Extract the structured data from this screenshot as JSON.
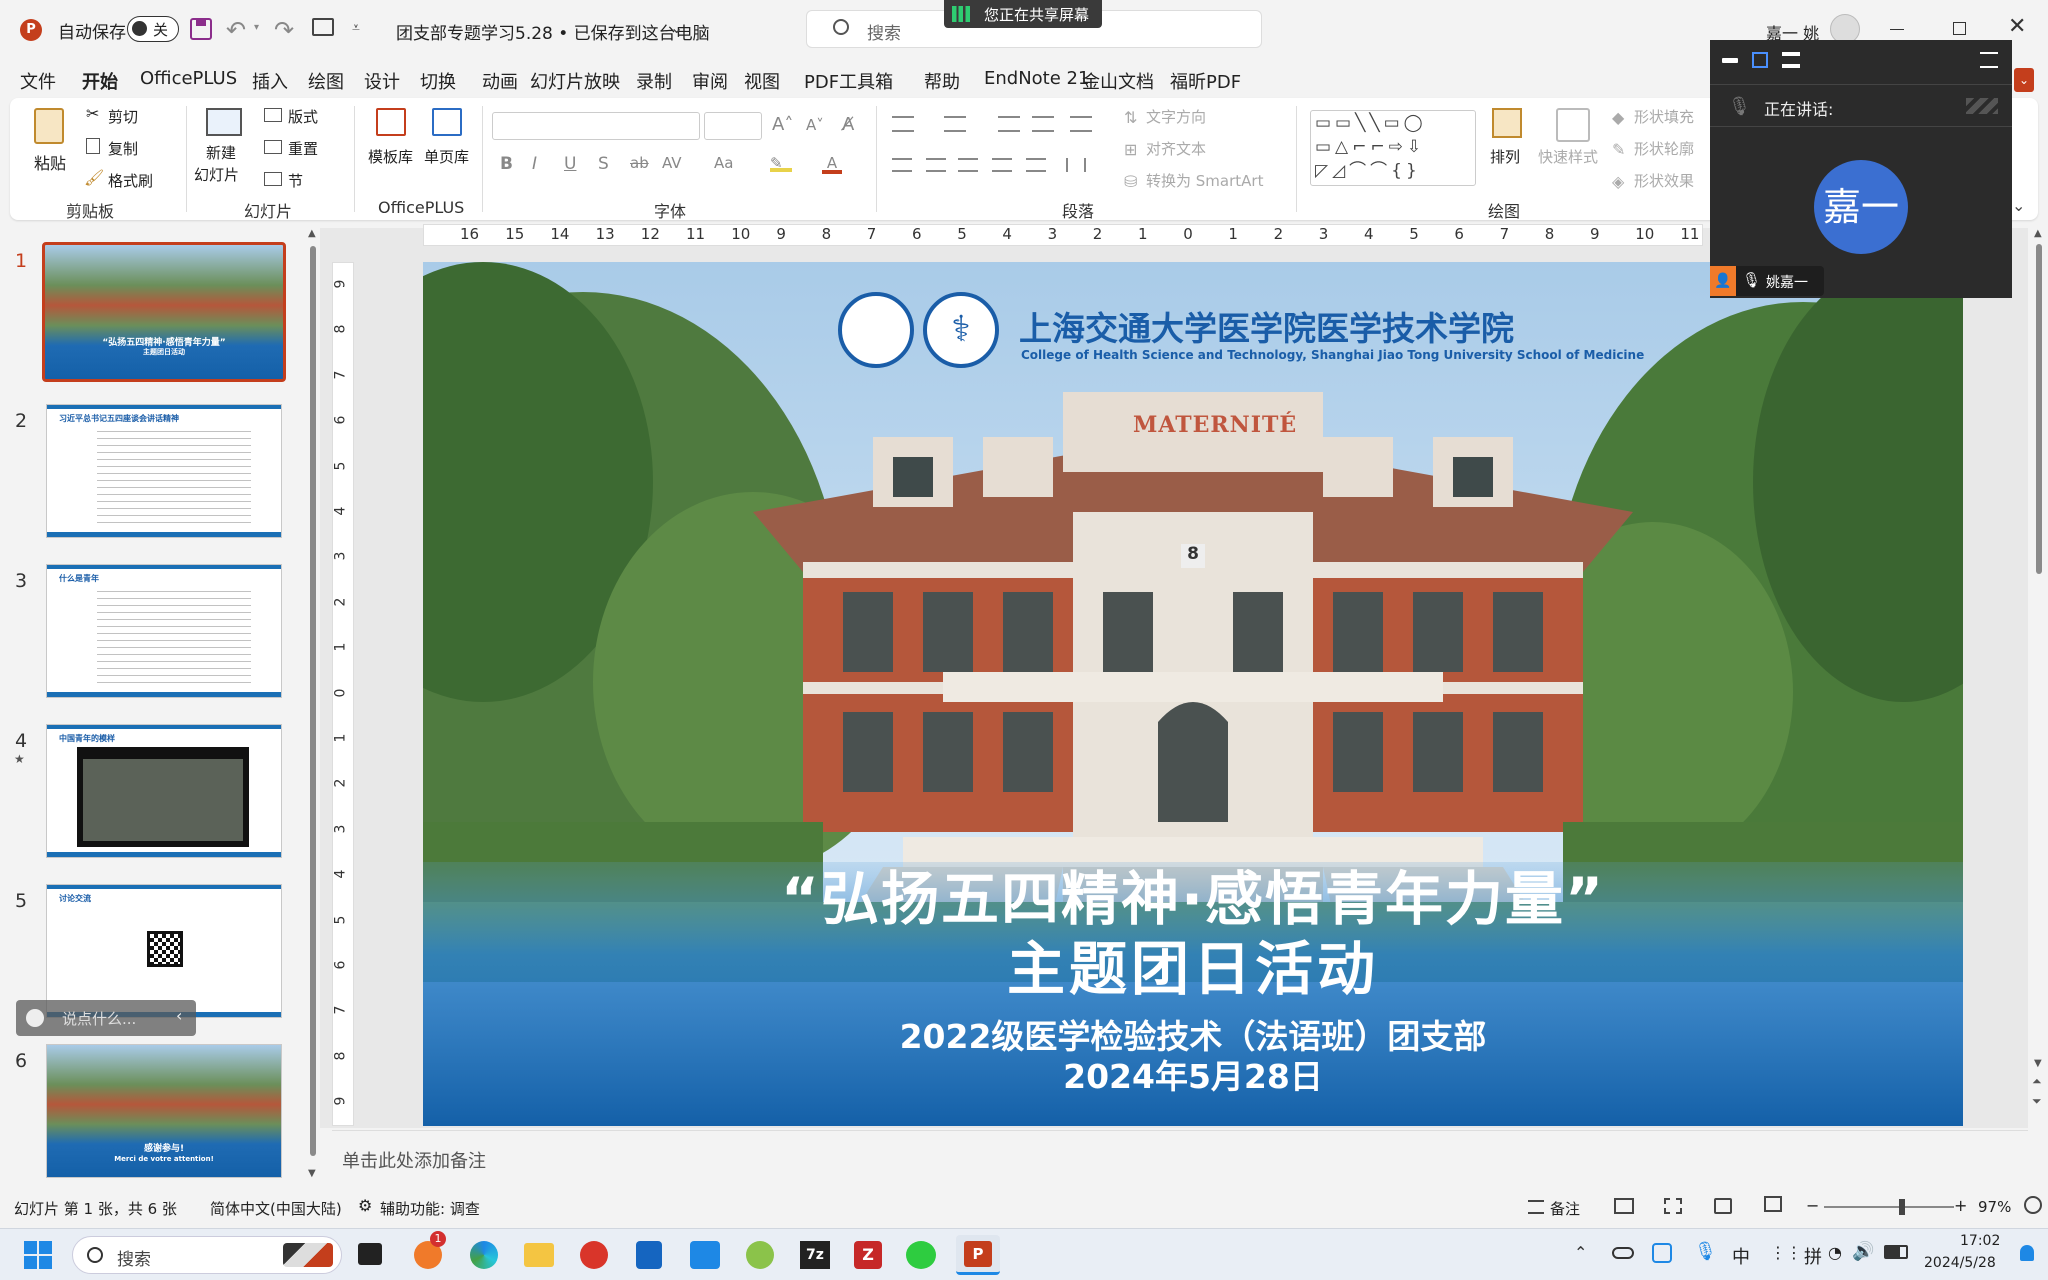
{
  "app": {
    "autosave_label": "自动保存",
    "autosave_state": "关",
    "doc_title": "团支部专题学习5.28 • 已保存到这台电脑",
    "search_placeholder": "搜索",
    "sharing_banner": "您正在共享屏幕",
    "user_name": "嘉一 姚"
  },
  "menu": [
    "文件",
    "开始",
    "OfficePLUS",
    "插入",
    "绘图",
    "设计",
    "切换",
    "动画",
    "幻灯片放映",
    "录制",
    "审阅",
    "视图",
    "PDF工具箱",
    "帮助",
    "EndNote 21",
    "金山文档",
    "福昕PDF"
  ],
  "menu_active": "开始",
  "ribbon": {
    "clipboard": {
      "paste": "粘贴",
      "cut": "剪切",
      "copy": "复制",
      "format_painter": "格式刷",
      "label": "剪贴板"
    },
    "slides": {
      "new_slide_1": "新建",
      "new_slide_2": "幻灯片",
      "layout": "版式",
      "reset": "重置",
      "section": "节",
      "label": "幻灯片"
    },
    "officeplus": {
      "template": "模板库",
      "single": "单页库",
      "label": "OfficePLUS"
    },
    "font": {
      "label": "字体"
    },
    "paragraph": {
      "text_direction": "文字方向",
      "align_text": "对齐文本",
      "smartart": "转换为 SmartArt",
      "label": "段落"
    },
    "drawing": {
      "arrange": "排列",
      "quick_styles": "快速样式",
      "shape_fill": "形状填充",
      "shape_outline": "形状轮廓",
      "shape_effects": "形状效果",
      "label": "绘图"
    }
  },
  "ruler": {
    "h": [
      "16",
      "15",
      "14",
      "13",
      "12",
      "11",
      "10",
      "9",
      "8",
      "7",
      "6",
      "5",
      "4",
      "3",
      "2",
      "1",
      "0",
      "1",
      "2",
      "3",
      "4",
      "5",
      "6",
      "7",
      "8",
      "9",
      "10",
      "11"
    ],
    "v": [
      "9",
      "8",
      "7",
      "6",
      "5",
      "4",
      "3",
      "2",
      "1",
      "0",
      "1",
      "2",
      "3",
      "4",
      "5",
      "6",
      "7",
      "8",
      "9"
    ]
  },
  "thumbnails": [
    {
      "num": "1",
      "title": "“弘扬五四精神·感悟青年力量”",
      "sub": "主题团日活动",
      "star": ""
    },
    {
      "num": "2",
      "title": "习近平总书记五四座谈会讲话精神",
      "sub": "",
      "star": ""
    },
    {
      "num": "3",
      "title": "什么是青年",
      "sub": "",
      "star": ""
    },
    {
      "num": "4",
      "title": "中国青年的模样",
      "sub": "",
      "star": "★"
    },
    {
      "num": "5",
      "title": "讨论交流",
      "sub": "",
      "star": ""
    },
    {
      "num": "6",
      "title": "感谢参与!",
      "sub": "Merci de votre attention!",
      "star": ""
    }
  ],
  "chat_popup": "说点什么...",
  "slide": {
    "school_cn": "上海交通大学医学院医学技术学院",
    "school_en": "College of Health Science and Technology, Shanghai Jiao Tong University School of Medicine",
    "building_sign": "MATERNITÉ",
    "building_number": "8",
    "title_line1": "“弘扬五四精神·感悟青年力量”",
    "title_line2": "主题团日活动",
    "sub_line1": "2022级医学检验技术（法语班）团支部",
    "sub_line2": "2024年5月28日"
  },
  "notes_placeholder": "单击此处添加备注",
  "status": {
    "slide_info": "幻灯片 第 1 张，共 6 张",
    "language": "简体中文(中国大陆)",
    "accessibility": "辅助功能: 调查",
    "notes": "备注",
    "zoom": "97%",
    "zoom_level": 0.6
  },
  "overlay": {
    "speaking_label": "正在讲话:",
    "avatar_text": "嘉一",
    "participant": "姚嘉一"
  },
  "taskbar": {
    "search_placeholder": "搜索",
    "time": "17:02",
    "date": "2024/5/28",
    "ime_1": "中",
    "ime_2": "拼",
    "notification_badge": "1"
  },
  "colors": {
    "accent": "#c43e1c",
    "slide_blue": "#1a6fb5",
    "avatar_blue": "#3b6fd1"
  }
}
